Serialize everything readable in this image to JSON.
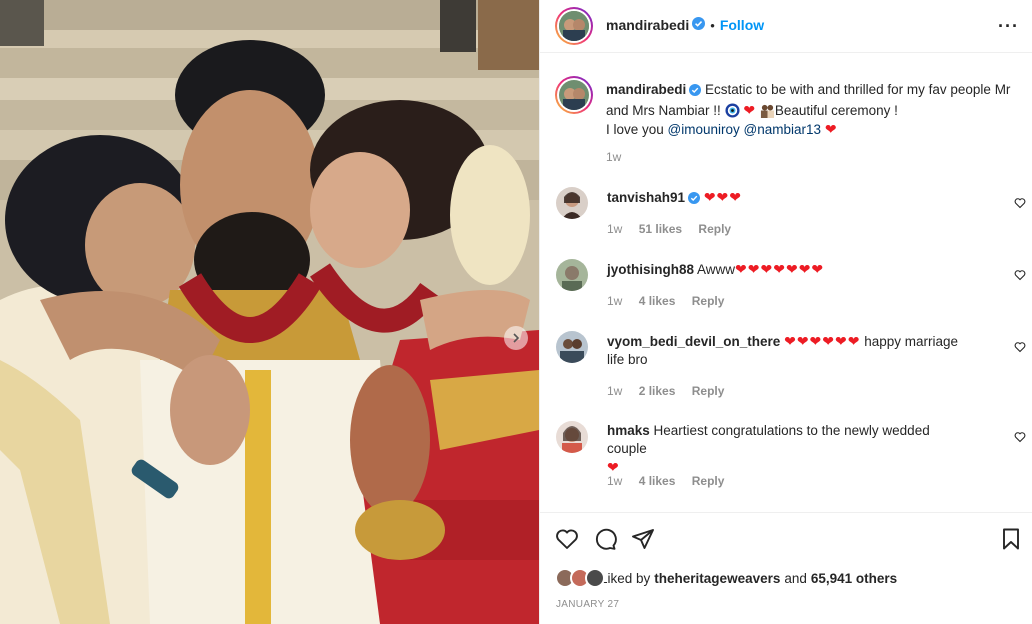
{
  "header": {
    "username": "mandirabedi",
    "follow_label": "Follow",
    "separator": "•",
    "more_label": "···"
  },
  "caption": {
    "username": "mandirabedi",
    "text_part1": "Ecstatic to be with and thrilled for my fav people Mr and Mrs Nambiar !! ",
    "text_part2": "Beautiful ceremony !",
    "text_part3": "I love you ",
    "mention1": "@imouniroy",
    "mention2": "@nambiar13",
    "time": "1w"
  },
  "comments": [
    {
      "username": "tanvishah91",
      "verified": true,
      "text": "",
      "hearts": "❤❤❤",
      "time": "1w",
      "likes": "51 likes",
      "reply": "Reply"
    },
    {
      "username": "jyothisingh88",
      "verified": false,
      "text": "Awww",
      "hearts": "❤❤❤❤❤❤❤",
      "time": "1w",
      "likes": "4 likes",
      "reply": "Reply"
    },
    {
      "username": "vyom_bedi_devil_on_there",
      "verified": false,
      "text": "happy marriage life bro",
      "hearts": "❤❤❤❤❤❤",
      "time": "1w",
      "likes": "2 likes",
      "reply": "Reply"
    },
    {
      "username": "hmaks",
      "verified": false,
      "text": "Heartiest congratulations to the newly wedded couple",
      "hearts": "❤",
      "time": "1w",
      "likes": "4 likes",
      "reply": "Reply"
    }
  ],
  "likes": {
    "prefix": "Liked by ",
    "user": "theheritageweavers",
    "middle": " and ",
    "others": "65,941 others"
  },
  "date": "JANUARY 27",
  "colors": {
    "accent": "#0095f6",
    "verified": "#3897f0",
    "heart": "#ed1c24",
    "muted": "#8e8e8e"
  }
}
